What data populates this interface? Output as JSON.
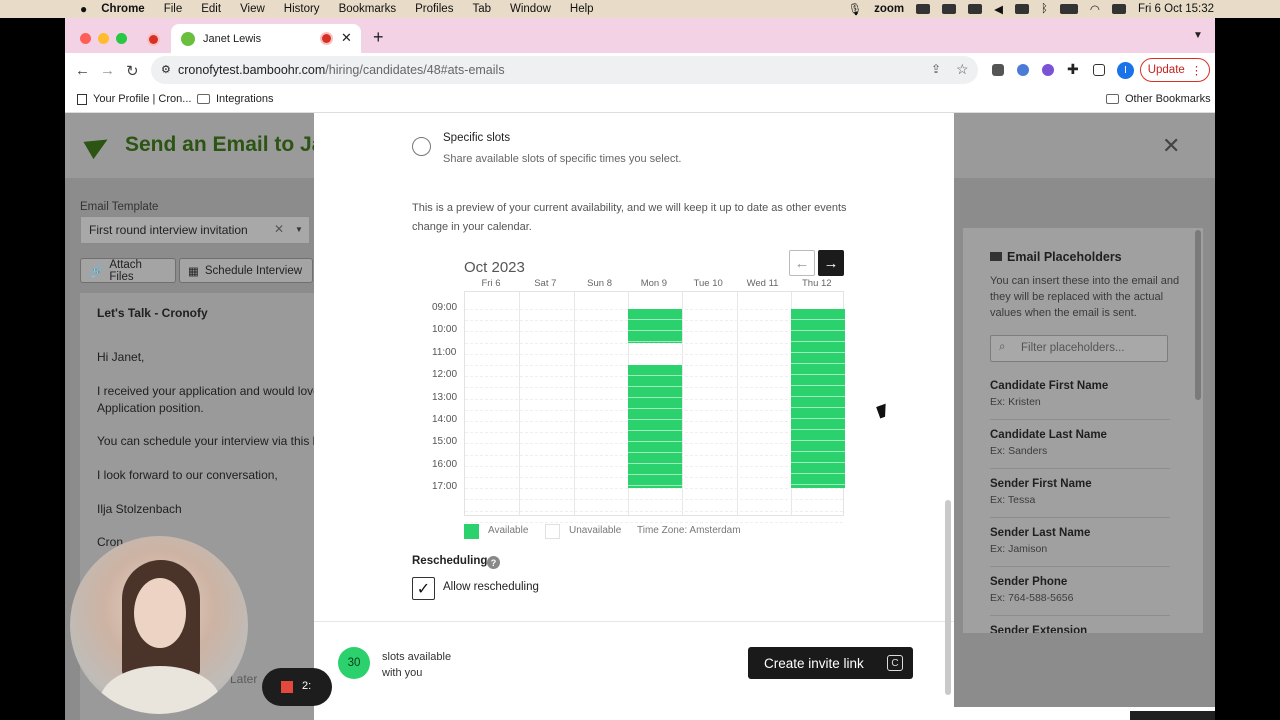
{
  "menubar": {
    "app": "Chrome",
    "items": [
      "File",
      "Edit",
      "View",
      "History",
      "Bookmarks",
      "Profiles",
      "Tab",
      "Window",
      "Help"
    ],
    "zoom_label": "zoom",
    "datetime": "Fri 6 Oct  15:32"
  },
  "browser": {
    "tab_title": "Janet Lewis",
    "url_host": "cronofytest.bamboohr.com",
    "url_path": "/hiring/candidates/48#ats-emails",
    "update_label": "Update",
    "profile_initial": "I",
    "bookmarks": [
      "Your Profile | Cron...",
      "Integrations"
    ],
    "other_bookmarks": "Other Bookmarks"
  },
  "page": {
    "title": "Send an Email to Ja",
    "template_label": "Email Template",
    "template_value": "First round interview invitation",
    "attach_label": "Attach Files",
    "schedule_label": "Schedule Interview",
    "email_lines": [
      "Let's Talk - Cronofy",
      "Hi Janet,",
      "I received your application and would love",
      "Application position.",
      "You can schedule your interview via this li",
      "I look forward to our conversation,",
      "Ilja Stolzenbach",
      "Cron"
    ],
    "later_fragment": "Later"
  },
  "placeholders": {
    "heading": "Email Placeholders",
    "description": "You can insert these into the email and they will be replaced with the actual values when the email is sent.",
    "search_placeholder": "Filter placeholders...",
    "items": [
      {
        "name": "Candidate First Name",
        "example": "Ex: Kristen"
      },
      {
        "name": "Candidate Last Name",
        "example": "Ex: Sanders"
      },
      {
        "name": "Sender First Name",
        "example": "Ex: Tessa"
      },
      {
        "name": "Sender Last Name",
        "example": "Ex: Jamison"
      },
      {
        "name": "Sender Phone",
        "example": "Ex: 764-588-5656"
      },
      {
        "name": "Sender Extension",
        "example": ""
      }
    ]
  },
  "modal": {
    "slots_option_title": "Specific slots",
    "slots_option_desc": "Share available slots of specific times you select.",
    "preview_text": "This is a preview of your current availability, and we will keep it up to date as other events change in your calendar.",
    "calendar": {
      "month": "Oct 2023",
      "days": [
        "Fri 6",
        "Sat 7",
        "Sun 8",
        "Mon 9",
        "Tue 10",
        "Wed 11",
        "Thu 12"
      ],
      "times": [
        "09:00",
        "10:00",
        "11:00",
        "12:00",
        "13:00",
        "14:00",
        "15:00",
        "16:00",
        "17:00"
      ],
      "available": [
        {
          "day": "Mon 9",
          "from": "09:00",
          "to": "10:30"
        },
        {
          "day": "Mon 9",
          "from": "11:30",
          "to": "17:00"
        },
        {
          "day": "Thu 12",
          "from": "09:00",
          "to": "17:00"
        }
      ],
      "available_color": "#2bd16d"
    },
    "legend_available": "Available",
    "legend_unavailable": "Unavailable",
    "timezone": "Time Zone: Amsterdam",
    "rescheduling_title": "Rescheduling",
    "allow_rescheduling_label": "Allow rescheduling",
    "allow_rescheduling_checked": true,
    "slots_count": "30",
    "slots_available_text": "slots available with you",
    "create_link_label": "Create invite link"
  },
  "overlay": {
    "recording_time": "2:"
  }
}
